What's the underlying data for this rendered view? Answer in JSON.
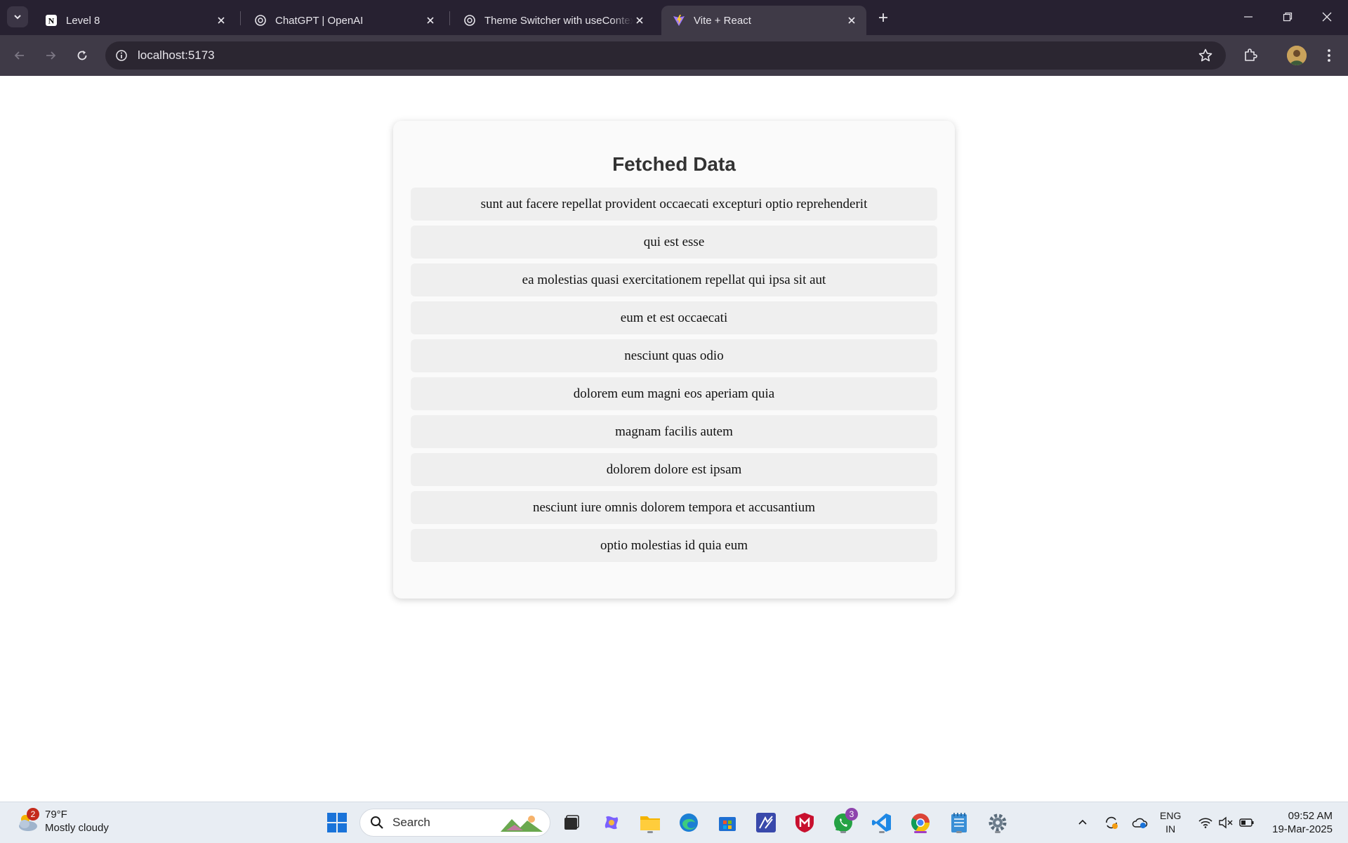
{
  "browser": {
    "tabs": [
      {
        "title": "Level 8",
        "favicon": "notion-icon"
      },
      {
        "title": "ChatGPT | OpenAI",
        "favicon": "openai-icon"
      },
      {
        "title": "Theme Switcher with useContext",
        "favicon": "openai-icon"
      },
      {
        "title": "Vite + React",
        "favicon": "vite-icon",
        "active": true
      }
    ],
    "url": "localhost:5173"
  },
  "page": {
    "heading": "Fetched Data",
    "items": [
      "sunt aut facere repellat provident occaecati excepturi optio reprehenderit",
      "qui est esse",
      "ea molestias quasi exercitationem repellat qui ipsa sit aut",
      "eum et est occaecati",
      "nesciunt quas odio",
      "dolorem eum magni eos aperiam quia",
      "magnam facilis autem",
      "dolorem dolore est ipsam",
      "nesciunt iure omnis dolorem tempora et accusantium",
      "optio molestias id quia eum"
    ]
  },
  "taskbar": {
    "weather": {
      "temp": "79°F",
      "condition": "Mostly cloudy",
      "badge": "2"
    },
    "search_label": "Search",
    "whatsapp_badge": "3",
    "lang": {
      "line1": "ENG",
      "line2": "IN"
    },
    "clock": {
      "time": "09:52 AM",
      "date": "19-Mar-2025"
    }
  },
  "colors": {
    "tabstrip": "#272131",
    "toolbar": "#3f3a47",
    "card": "#fafafa",
    "list_item": "#efefef",
    "taskbar": "#e8edf3"
  }
}
